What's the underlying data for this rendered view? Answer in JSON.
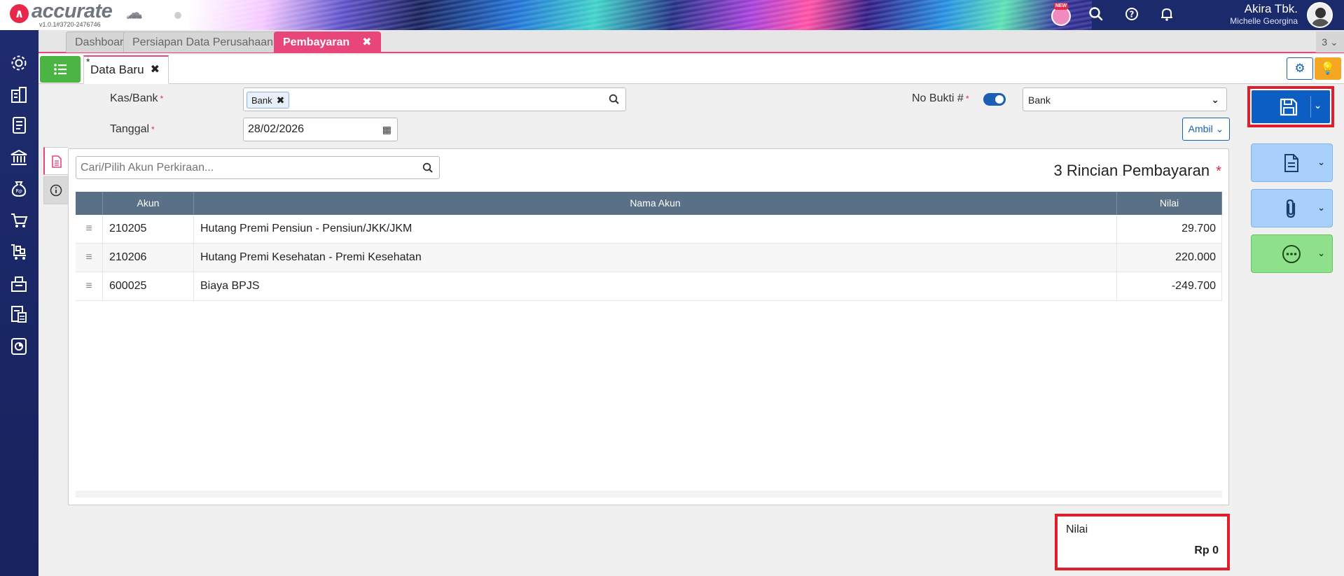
{
  "app": {
    "brand": "accurate",
    "brand_sub": "online",
    "version": "v1.0.1#3720-2476746",
    "new_badge": "NEW",
    "company": "Akira Tbk.",
    "user": "Michelle Georgina"
  },
  "tabs": [
    {
      "label": "Dashboard"
    },
    {
      "label": "Persiapan Data Perusahaan"
    },
    {
      "label": "Pembayaran",
      "close": "✖"
    }
  ],
  "tab_counter": "3",
  "subtab": {
    "modified_mark": "*",
    "label": "Data Baru",
    "close": "✖"
  },
  "form": {
    "kas_bank_label": "Kas/Bank",
    "kas_bank_value": "Bank",
    "tanggal_label": "Tanggal",
    "tanggal_value": "28/02/2026",
    "no_bukti_label": "No Bukti #",
    "no_bukti_type": "Bank",
    "required_mark": "*",
    "ambil_label": "Ambil"
  },
  "detail": {
    "search_placeholder": "Cari/Pilih Akun Perkiraan...",
    "count_title": "3 Rincian Pembayaran",
    "columns": [
      "Akun",
      "Nama Akun",
      "Nilai"
    ],
    "rows": [
      {
        "akun": "210205",
        "nama": "Hutang Premi Pensiun - Pensiun/JKK/JKM",
        "nilai": "29.700"
      },
      {
        "akun": "210206",
        "nama": "Hutang Premi Kesehatan - Premi Kesehatan",
        "nilai": "220.000"
      },
      {
        "akun": "600025",
        "nama": "Biaya BPJS",
        "nilai": "-249.700"
      }
    ]
  },
  "total": {
    "label": "Nilai",
    "value": "Rp 0"
  },
  "colors": {
    "accent_pink": "#e8467a",
    "primary_blue": "#0d5ec2",
    "sidebar": "#1e2b6e",
    "highlight_red": "#e01e2b",
    "success_green": "#4bb543"
  }
}
